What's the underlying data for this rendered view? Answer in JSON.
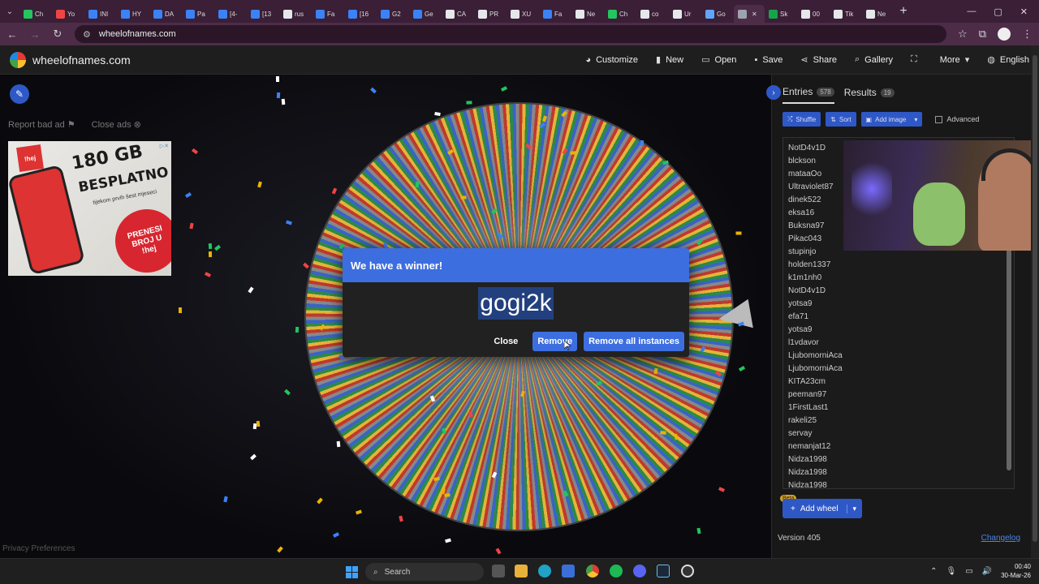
{
  "browser": {
    "tabs": [
      {
        "label": "Ch",
        "color": "#22c55e"
      },
      {
        "label": "Yo",
        "color": "#ef4444"
      },
      {
        "label": "INI",
        "color": "#3b82f6"
      },
      {
        "label": "HY",
        "color": "#3b82f6"
      },
      {
        "label": "DA",
        "color": "#3b82f6"
      },
      {
        "label": "Pa",
        "color": "#3b82f6"
      },
      {
        "label": "[4-",
        "color": "#3b82f6"
      },
      {
        "label": "[13",
        "color": "#3b82f6"
      },
      {
        "label": "rus",
        "color": "#e5e7eb"
      },
      {
        "label": "Fa",
        "color": "#3b82f6"
      },
      {
        "label": "[16",
        "color": "#3b82f6"
      },
      {
        "label": "G2",
        "color": "#3b82f6"
      },
      {
        "label": "Ge",
        "color": "#3b82f6"
      },
      {
        "label": "CA",
        "color": "#e5e7eb"
      },
      {
        "label": "PR",
        "color": "#e5e7eb"
      },
      {
        "label": "XU",
        "color": "#e5e7eb"
      },
      {
        "label": "Fa",
        "color": "#3b82f6"
      },
      {
        "label": "Ne",
        "color": "#e5e7eb"
      },
      {
        "label": "Ch",
        "color": "#22c55e"
      },
      {
        "label": "co",
        "color": "#e5e7eb"
      },
      {
        "label": "Ur",
        "color": "#e5e7eb"
      },
      {
        "label": "Go",
        "color": "#60a5fa"
      },
      {
        "label": "",
        "color": "#9ca3af",
        "active": true
      },
      {
        "label": "Sk",
        "color": "#16a34a"
      },
      {
        "label": "00",
        "color": "#e5e7eb"
      },
      {
        "label": "Tik",
        "color": "#e5e7eb"
      },
      {
        "label": "Ne",
        "color": "#e5e7eb"
      }
    ],
    "url": "wheelofnames.com"
  },
  "header": {
    "logo_text": "wheelofnames.com",
    "menu": [
      {
        "id": "customize",
        "label": "Customize",
        "icon": "palette-icon",
        "glyph": "◕"
      },
      {
        "id": "new",
        "label": "New",
        "icon": "file-icon",
        "glyph": "▮"
      },
      {
        "id": "open",
        "label": "Open",
        "icon": "folder-icon",
        "glyph": "▭"
      },
      {
        "id": "save",
        "label": "Save",
        "icon": "save-icon",
        "glyph": "▪"
      },
      {
        "id": "share",
        "label": "Share",
        "icon": "share-icon",
        "glyph": "⋖"
      },
      {
        "id": "gallery",
        "label": "Gallery",
        "icon": "search-icon",
        "glyph": "⌕"
      },
      {
        "id": "fullscreen",
        "label": "",
        "icon": "fullscreen-icon",
        "glyph": "⛶"
      },
      {
        "id": "more",
        "label": "More",
        "icon": "caret-down-icon",
        "glyph": "▾"
      },
      {
        "id": "language",
        "label": "English",
        "icon": "globe-icon",
        "glyph": "◍"
      }
    ]
  },
  "ads": {
    "report_label": "Report bad ad",
    "close_label": "Close ads",
    "banner": {
      "brand": "!hej",
      "headline": "180 GB",
      "headline2": "BESPLATNO",
      "subline": "tijekom prvih šest mjeseci",
      "circle_line1": "PRENESI",
      "circle_line2": "BROJ U",
      "circle_line3": "!hej"
    }
  },
  "privacy_label": "Privacy Preferences",
  "dialog": {
    "title": "We have a winner!",
    "winner": "gogi2k",
    "close_label": "Close",
    "remove_label": "Remove",
    "remove_all_label": "Remove all instances"
  },
  "panel": {
    "tabs": [
      {
        "label": "Entries",
        "count": "578",
        "active": true
      },
      {
        "label": "Results",
        "count": "19",
        "active": false
      }
    ],
    "tools": {
      "shuffle": "Shuffle",
      "sort": "Sort",
      "add_image": "Add image",
      "advanced": "Advanced"
    },
    "entries": [
      "NotD4v1D",
      "blckson",
      "mataaOo",
      "Ultraviolet87",
      "dinek522",
      "eksa16",
      "Buksna97",
      "Pikac043",
      "stupinjo",
      "holden1337",
      "k1m1nh0",
      "NotD4v1D",
      "yotsa9",
      "efa71",
      "yotsa9",
      "l1vdavor",
      "LjubomorniAca",
      "LjubomorniAca",
      "KITA23cm",
      "peeman97",
      "1FirstLast1",
      "rakeli25",
      "servay",
      "nemanjat12",
      "Nidza1998",
      "Nidza1998",
      "Nidza1998"
    ],
    "beta_label": "Beta",
    "add_wheel_label": "Add wheel",
    "version": "Version 405",
    "changelog": "Changelog"
  },
  "taskbar": {
    "search_label": "Search",
    "time": "00:40",
    "date": "30-Mar-26"
  }
}
